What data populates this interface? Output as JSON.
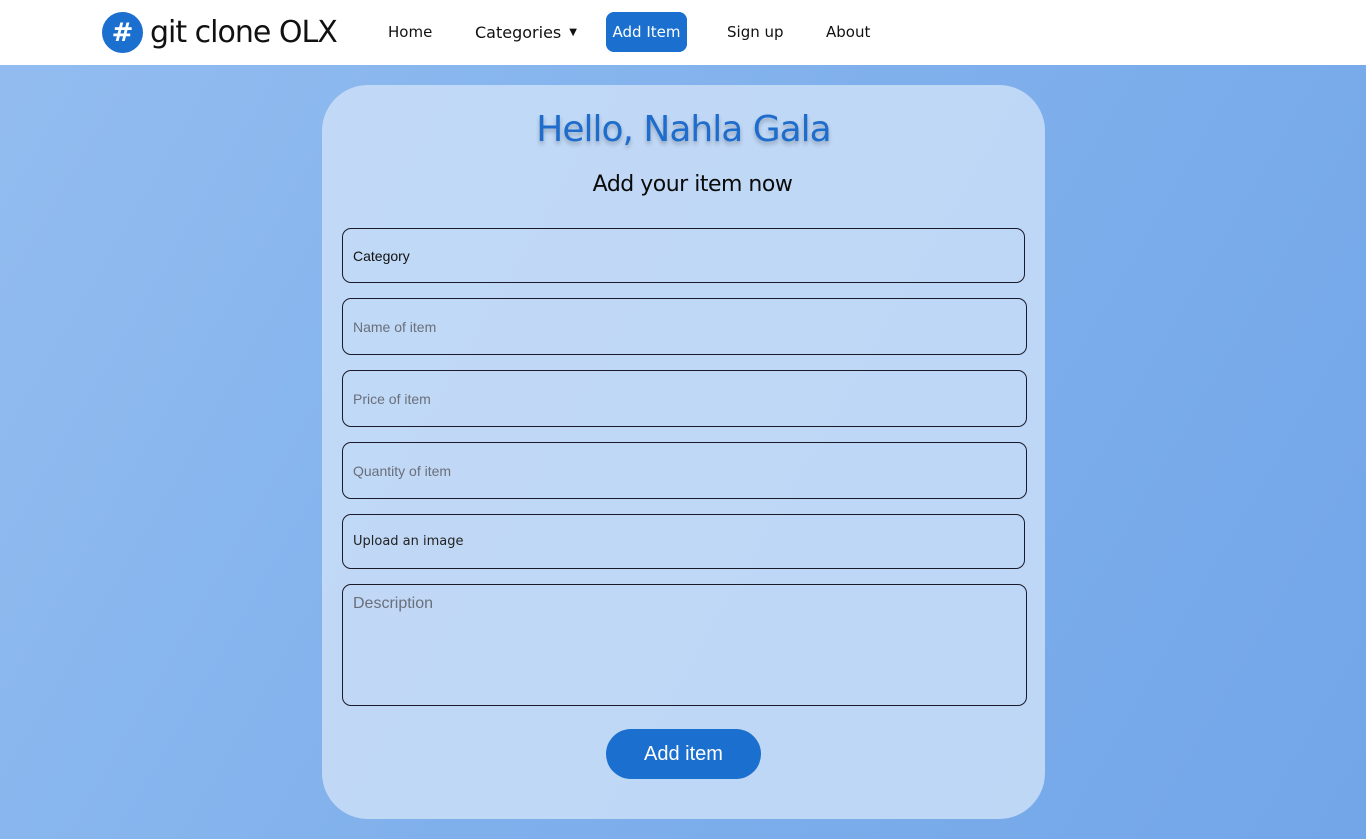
{
  "brand": {
    "icon": "hashtag-icon",
    "icon_glyph": "#",
    "name": "git clone OLX"
  },
  "nav": {
    "home": "Home",
    "categories": "Categories",
    "categories_caret": "▼",
    "add_item": "Add Item",
    "sign_up": "Sign up",
    "about": "About"
  },
  "form": {
    "greeting": "Hello, Nahla Gala",
    "subtitle": "Add your item now",
    "category": "Category",
    "name_placeholder": "Name of item",
    "price_placeholder": "Price of item",
    "quantity_placeholder": "Quantity of item",
    "upload": "Upload an image",
    "description_placeholder": "Description",
    "submit": "Add item"
  },
  "colors": {
    "accent": "#1b6fce",
    "background_start": "#93bdf0",
    "background_end": "#72a6e9"
  }
}
